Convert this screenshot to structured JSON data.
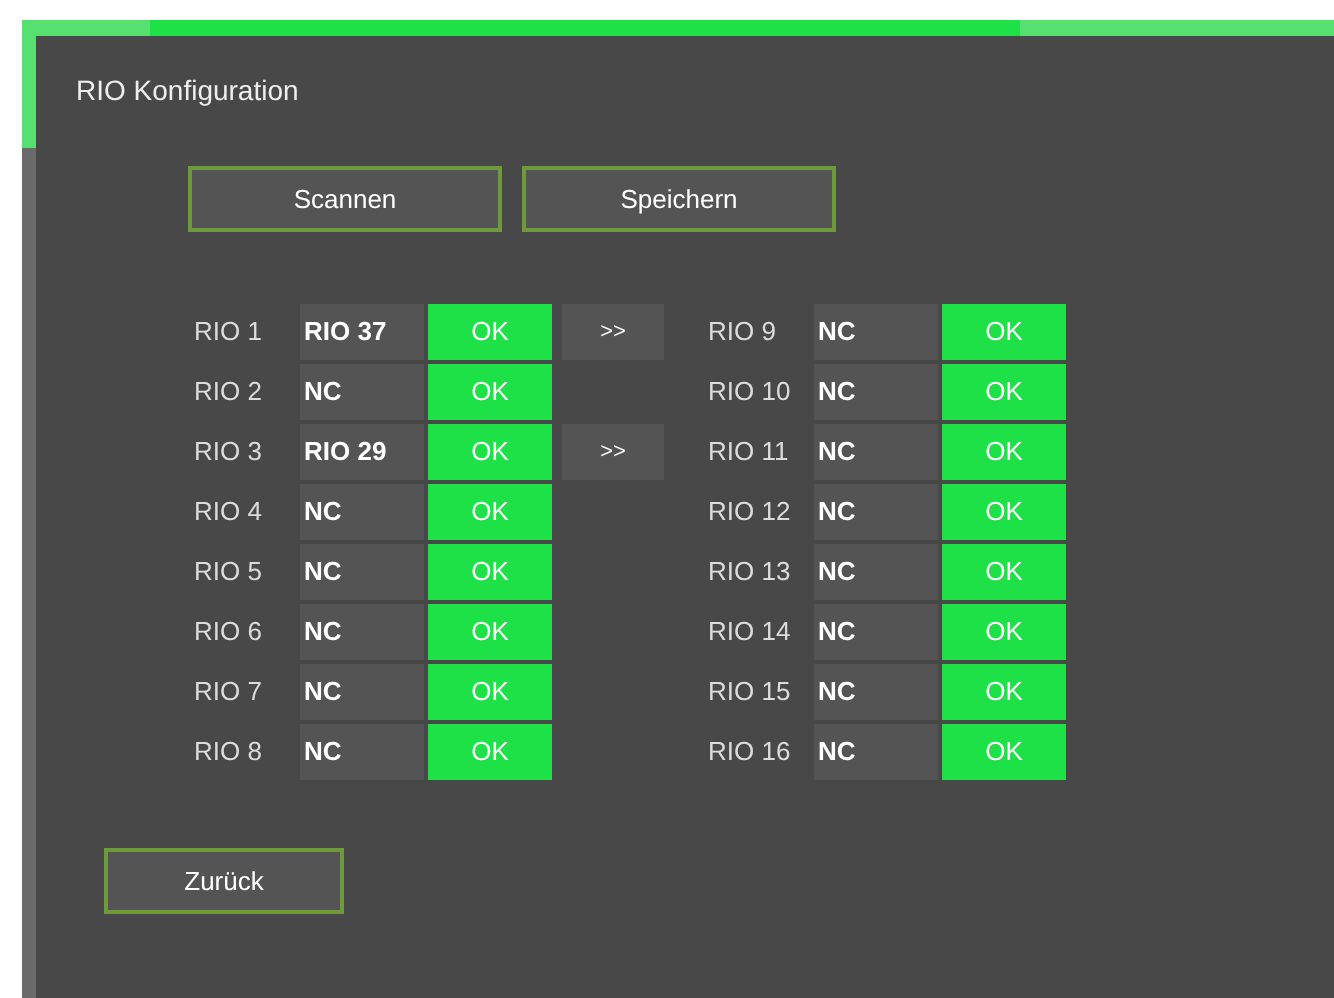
{
  "dialog": {
    "title": "RIO Konfiguration"
  },
  "actions": [
    "Scannen",
    "Speichern"
  ],
  "columns": [
    {
      "rows": [
        {
          "label": "RIO 1",
          "device": "RIO 37",
          "status": "OK",
          "ok": true,
          "forward": ">>"
        },
        {
          "label": "RIO 2",
          "device": "NC",
          "status": "OK",
          "ok": true
        },
        {
          "label": "RIO 3",
          "device": "RIO 29",
          "status": "OK",
          "ok": true,
          "forward": ">>"
        },
        {
          "label": "RIO 4",
          "device": "NC",
          "status": "OK",
          "ok": true
        },
        {
          "label": "RIO 5",
          "device": "NC",
          "status": "OK",
          "ok": true
        },
        {
          "label": "RIO 6",
          "device": "NC",
          "status": "OK",
          "ok": true
        },
        {
          "label": "RIO 7",
          "device": "NC",
          "status": "OK",
          "ok": true
        },
        {
          "label": "RIO 8",
          "device": "NC",
          "status": "OK",
          "ok": true
        }
      ]
    },
    {
      "rows": [
        {
          "label": "RIO 9",
          "device": "NC",
          "status": "OK",
          "ok": true
        },
        {
          "label": "RIO 10",
          "device": "NC",
          "status": "OK",
          "ok": true
        },
        {
          "label": "RIO 11",
          "device": "NC",
          "status": "OK",
          "ok": true
        },
        {
          "label": "RIO 12",
          "device": "NC",
          "status": "OK",
          "ok": true
        },
        {
          "label": "RIO 13",
          "device": "NC",
          "status": "OK",
          "ok": true
        },
        {
          "label": "RIO 14",
          "device": "NC",
          "status": "OK",
          "ok": true
        },
        {
          "label": "RIO 15",
          "device": "NC",
          "status": "OK",
          "ok": true
        },
        {
          "label": "RIO 16",
          "device": "NC",
          "status": "OK",
          "ok": true
        }
      ]
    }
  ],
  "back_button": "Zurück"
}
